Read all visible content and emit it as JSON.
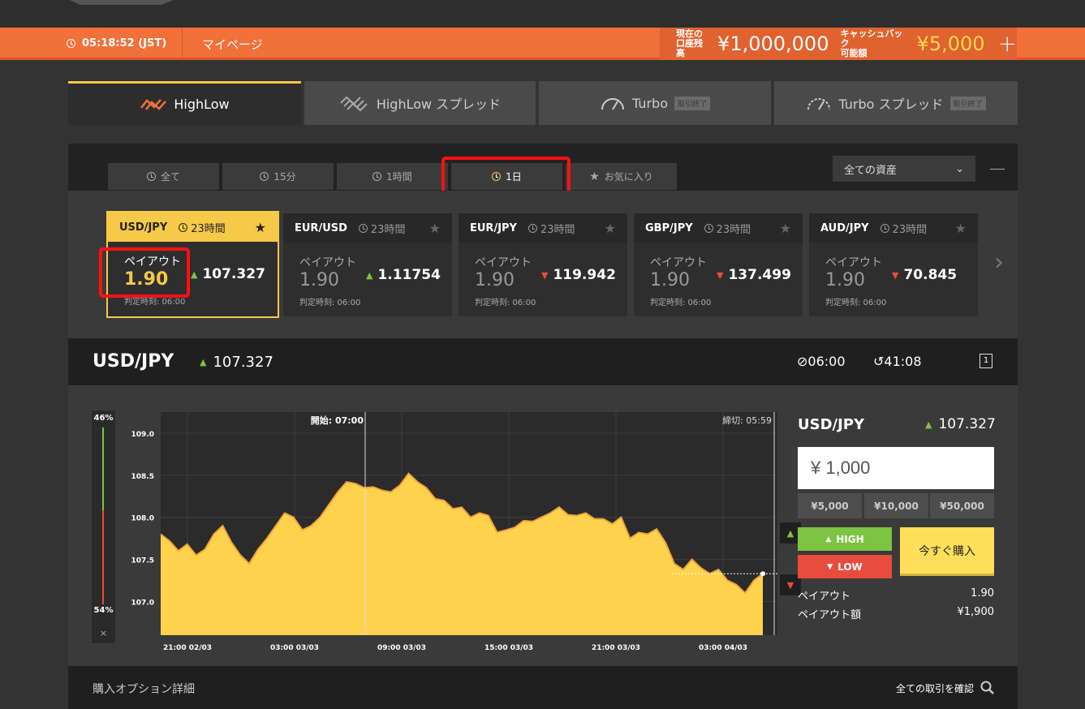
{
  "header": {
    "clock": "05:18:52 (JST)",
    "mypage": "マイページ",
    "balance_label_1": "現在の",
    "balance_label_2": "口座残高",
    "balance": "¥1,000,000",
    "cashback_label_1": "キャッシュバック",
    "cashback_label_2": "可能額",
    "cashback": "¥5,000"
  },
  "product_tabs": [
    {
      "label": "HighLow",
      "badge": ""
    },
    {
      "label": "HighLow スプレッド",
      "badge": ""
    },
    {
      "label": "Turbo",
      "badge": "取引終了"
    },
    {
      "label": "Turbo スプレッド",
      "badge": "取引終了"
    }
  ],
  "filter_tabs": [
    "全て",
    "15分",
    "1時間",
    "1日",
    "お気に入り"
  ],
  "asset_select": "全ての資産",
  "cards": [
    {
      "pair": "USD/JPY",
      "time": "23時間",
      "payout_label": "ペイアウト",
      "payout": "1.90",
      "rate": "107.327",
      "dir": "up",
      "deadline": "判定時刻: 06:00"
    },
    {
      "pair": "EUR/USD",
      "time": "23時間",
      "payout_label": "ペイアウト",
      "payout": "1.90",
      "rate": "1.11754",
      "dir": "up",
      "deadline": "判定時刻: 06:00"
    },
    {
      "pair": "EUR/JPY",
      "time": "23時間",
      "payout_label": "ペイアウト",
      "payout": "1.90",
      "rate": "119.942",
      "dir": "down",
      "deadline": "判定時刻: 06:00"
    },
    {
      "pair": "GBP/JPY",
      "time": "23時間",
      "payout_label": "ペイアウト",
      "payout": "1.90",
      "rate": "137.499",
      "dir": "down",
      "deadline": "判定時刻: 06:00"
    },
    {
      "pair": "AUD/JPY",
      "time": "23時間",
      "payout_label": "ペイアウト",
      "payout": "1.90",
      "rate": "70.845",
      "dir": "down",
      "deadline": "判定時刻: 06:00"
    }
  ],
  "chart_header": {
    "symbol": "USD/JPY",
    "rate": "107.327",
    "close_time": "06:00",
    "timer": "41:08"
  },
  "sentiment": {
    "high": "46%",
    "low": "54%",
    "close": "×"
  },
  "chart_data": {
    "type": "area",
    "ylim": [
      106.6,
      109.25
    ],
    "yticks": [
      "109.0",
      "108.5",
      "108.0",
      "107.5",
      "107.0"
    ],
    "xticks": [
      "21:00 02/03",
      "03:00 03/03",
      "09:00 03/03",
      "15:00 03/03",
      "21:00 03/03",
      "03:00 04/03"
    ],
    "start_label": "開始: 07:00",
    "end_label": "締切: 05:59",
    "strike": 107.33,
    "series": [
      {
        "values": [
          107.8,
          107.72,
          107.6,
          107.68,
          107.55,
          107.62,
          107.8,
          107.9,
          107.7,
          107.55,
          107.45,
          107.62,
          107.75,
          107.9,
          108.05,
          108.0,
          107.85,
          107.9,
          108.0,
          108.15,
          108.3,
          108.42,
          108.4,
          108.35,
          108.36,
          108.32,
          108.3,
          108.38,
          108.52,
          108.42,
          108.35,
          108.22,
          108.2,
          108.1,
          108.12,
          108.0,
          108.05,
          108.02,
          107.82,
          107.85,
          107.88,
          107.96,
          107.95,
          108.0,
          108.05,
          108.12,
          108.03,
          108.02,
          108.05,
          107.98,
          107.98,
          107.92,
          108.0,
          107.75,
          107.82,
          107.8,
          107.86,
          107.7,
          107.45,
          107.38,
          107.5,
          107.4,
          107.33,
          107.38,
          107.25,
          107.2,
          107.1,
          107.25,
          107.33
        ]
      }
    ]
  },
  "trade_panel": {
    "symbol": "USD/JPY",
    "rate": "107.327",
    "amount": "¥ 1,000",
    "quick": [
      "¥5,000",
      "¥10,000",
      "¥50,000"
    ],
    "high": "HIGH",
    "low": "LOW",
    "buy": "今すぐ購入",
    "payout_label": "ペイアウト",
    "payout": "1.90",
    "payout_amount_label": "ペイアウト額",
    "payout_amount": "¥1,900"
  },
  "footer": {
    "buy_options": "購入オプション詳細",
    "all_trades": "全ての取引を確認"
  }
}
